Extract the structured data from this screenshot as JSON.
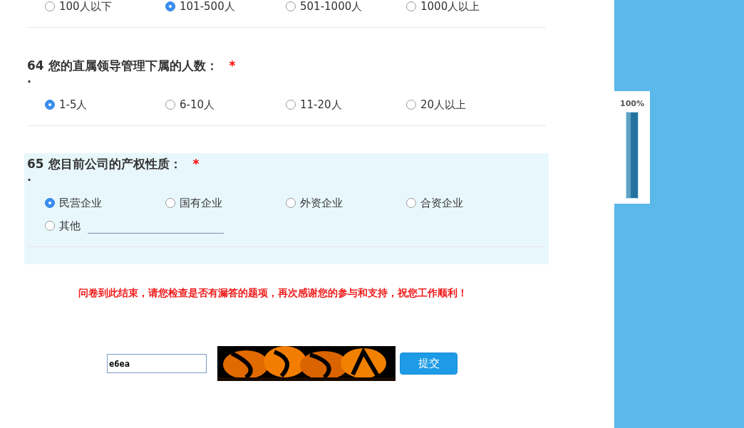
{
  "questions": [
    {
      "highlighted": false,
      "options": [
        {
          "kind": "choice",
          "label": "100人以下",
          "selected": false
        },
        {
          "kind": "choice",
          "label": "101-500人",
          "selected": true
        },
        {
          "kind": "choice",
          "label": "501-1000人",
          "selected": false
        },
        {
          "kind": "choice",
          "label": "1000人以上",
          "selected": false
        }
      ]
    },
    {
      "highlighted": false,
      "title": "64 您的直属领导管理下属的人数：",
      "required_mark": "*",
      "dot": ".",
      "options": [
        {
          "kind": "choice",
          "label": "1-5人",
          "selected": true
        },
        {
          "kind": "choice",
          "label": "6-10人",
          "selected": false
        },
        {
          "kind": "choice",
          "label": "11-20人",
          "selected": false
        },
        {
          "kind": "choice",
          "label": "20人以上",
          "selected": false
        }
      ]
    },
    {
      "highlighted": true,
      "title": "65 您目前公司的产权性质：",
      "required_mark": "*",
      "dot": ".",
      "options": [
        {
          "kind": "choice",
          "label": "民营企业",
          "selected": true
        },
        {
          "kind": "choice",
          "label": "国有企业",
          "selected": false
        },
        {
          "kind": "choice",
          "label": "外资企业",
          "selected": false
        },
        {
          "kind": "choice",
          "label": "合资企业",
          "selected": false
        },
        {
          "kind": "other",
          "label": "其他",
          "selected": false
        }
      ]
    }
  ],
  "closing_message": "问卷到此结束，请您检查是否有漏答的题项，再次感谢您的参与和支持，祝您工作顺利！",
  "captcha": {
    "value": "e6ea"
  },
  "submit_button": "提交",
  "progress": {
    "label": "100%",
    "level": 1
  }
}
